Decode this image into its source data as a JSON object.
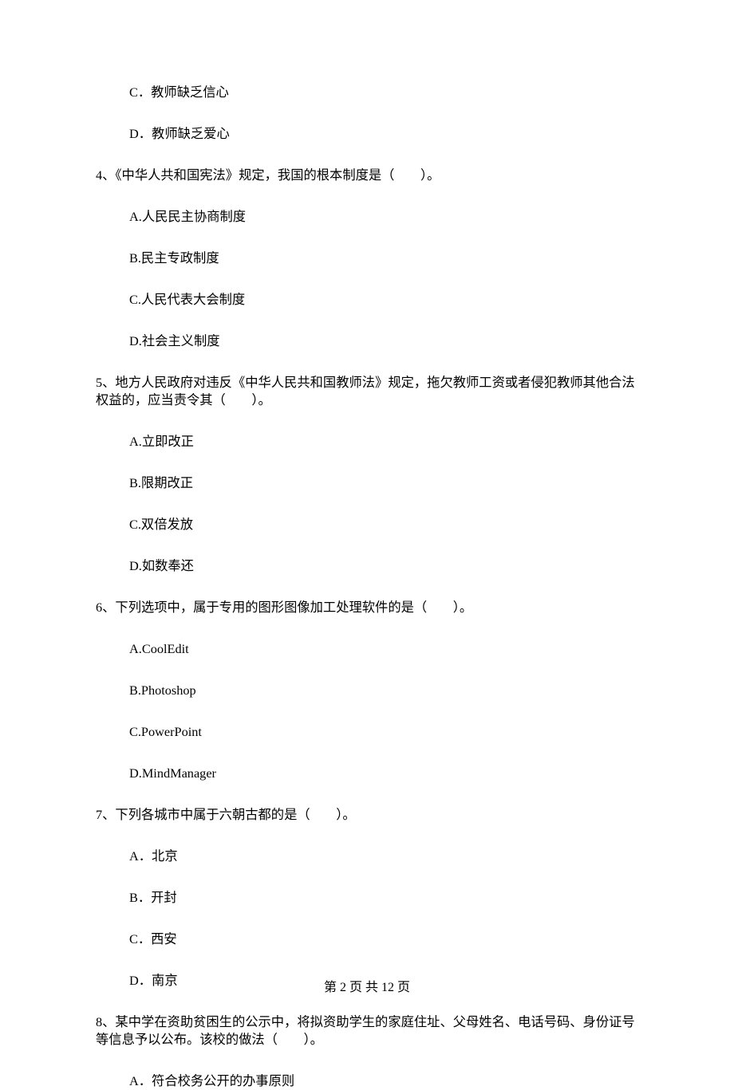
{
  "q3": {
    "options": {
      "C": "C．教师缺乏信心",
      "D": "D．教师缺乏爱心"
    }
  },
  "q4": {
    "stem": "4、《中华人共和国宪法》规定，我国的根本制度是（　　）。",
    "options": {
      "A": "A.人民民主协商制度",
      "B": "B.民主专政制度",
      "C": "C.人民代表大会制度",
      "D": "D.社会主义制度"
    }
  },
  "q5": {
    "stem": "5、地方人民政府对违反《中华人民共和国教师法》规定，拖欠教师工资或者侵犯教师其他合法权益的，应当责令其（　　）。",
    "options": {
      "A": "A.立即改正",
      "B": "B.限期改正",
      "C": "C.双倍发放",
      "D": "D.如数奉还"
    }
  },
  "q6": {
    "stem": "6、下列选项中，属于专用的图形图像加工处理软件的是（　　）。",
    "options": {
      "A": "A.CoolEdit",
      "B": "B.Photoshop",
      "C": "C.PowerPoint",
      "D": "D.MindManager"
    }
  },
  "q7": {
    "stem": "7、下列各城市中属于六朝古都的是（　　）。",
    "options": {
      "A": "A．北京",
      "B": "B．开封",
      "C": "C．西安",
      "D": "D．南京"
    }
  },
  "q8": {
    "stem": "8、某中学在资助贫困生的公示中，将拟资助学生的家庭住址、父母姓名、电话号码、身份证号等信息予以公布。该校的做法（　　）。",
    "options": {
      "A": "A．符合校务公开的办事原则"
    }
  },
  "footer": "第 2 页 共 12 页"
}
